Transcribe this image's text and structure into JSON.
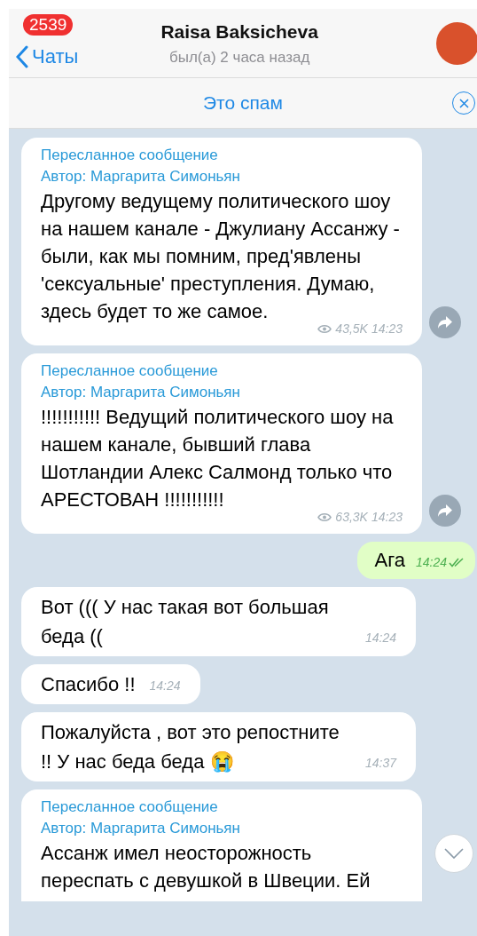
{
  "header": {
    "back_label": "Чаты",
    "unread_badge": "2539",
    "contact_name": "Raisa Baksicheva",
    "status": "был(а) 2 часа назад"
  },
  "spam_bar": {
    "label": "Это спам"
  },
  "messages": [
    {
      "kind": "forwarded",
      "forward_label": "Пересланное сообщение",
      "author": "Автор: Маргарита Симоньян",
      "text": "Другому ведущему политического шоу на нашем канале - Джулиану Ассанжу - были, как мы помним, пред'явлены 'сексуальные' преступления. Думаю, здесь будет то же самое.",
      "views": "43,5K",
      "time": "14:23"
    },
    {
      "kind": "forwarded",
      "forward_label": "Пересланное сообщение",
      "author": "Автор: Маргарита Симоньян",
      "text": "!!!!!!!!!!! Ведущий политического шоу на нашем канале, бывший глава Шотландии Алекс Салмонд только что АРЕСТОВАН !!!!!!!!!!!",
      "views": "63,3K",
      "time": "14:23"
    },
    {
      "kind": "outgoing",
      "text": "Ага",
      "time": "14:24",
      "read": true
    },
    {
      "kind": "incoming",
      "text": "Вот ((( У нас такая вот большая беда ((",
      "time": "14:24"
    },
    {
      "kind": "incoming",
      "text": "Спасибо !!",
      "time": "14:24"
    },
    {
      "kind": "incoming",
      "text": "Пожалуйста , вот это репостните !! У нас беда беда 😭",
      "time": "14:37"
    },
    {
      "kind": "forwarded_partial",
      "forward_label": "Пересланное сообщение",
      "author": "Автор: Маргарита Симоньян",
      "text": "Ассанж имел неосторожность переспать с девушкой в Швеции. Ей"
    }
  ]
}
